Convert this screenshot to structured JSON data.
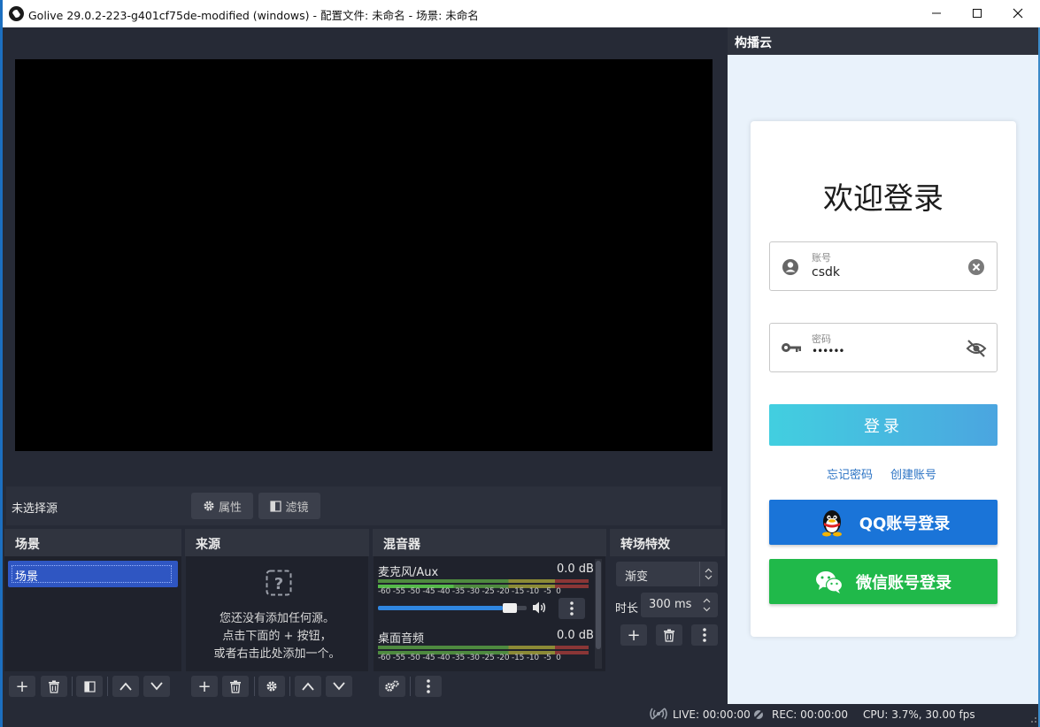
{
  "window": {
    "title": "Golive 29.0.2-223-g401cf75de-modified (windows) - 配置文件: 未命名 - 场景: 未命名",
    "minimize_glyph": "—",
    "maximize_glyph": "☐",
    "close_glyph": "✕"
  },
  "source_toolbar": {
    "no_source": "未选择源",
    "properties_label": "属性",
    "filters_label": "滤镜"
  },
  "scenes": {
    "header": "场景",
    "items": [
      "场景"
    ]
  },
  "sources": {
    "header": "来源",
    "empty_line1": "您还没有添加任何源。",
    "empty_line2": "点击下面的 + 按钮，",
    "empty_line3": "或者右击此处添加一个。"
  },
  "mixer": {
    "header": "混音器",
    "channels": [
      {
        "name": "麦克风/Aux",
        "level": "0.0 dB",
        "volume_fraction": 0.93
      },
      {
        "name": "桌面音频",
        "level": "0.0 dB"
      }
    ],
    "scale": [
      "-60",
      "-55",
      "-50",
      "-45",
      "-40",
      "-35",
      "-30",
      "-25",
      "-20",
      "-15",
      "-10",
      "-5",
      "0"
    ]
  },
  "transitions": {
    "header": "转场特效",
    "selected": "渐变",
    "duration_label": "时长",
    "duration_value": "300 ms"
  },
  "status": {
    "live": "LIVE: 00:00:00",
    "rec": "REC: 00:00:00",
    "cpu": "CPU: 3.7%, 30.00 fps"
  },
  "cloud": {
    "header": "构播云",
    "title": "欢迎登录",
    "account_label": "账号",
    "account_value": "csdk",
    "password_label": "密码",
    "password_value": "••••••",
    "login_button": "登录",
    "forgot_link": "忘记密码",
    "create_link": "创建账号",
    "qq_button": "QQ账号登录",
    "wechat_button": "微信账号登录"
  },
  "colors": {
    "panel_bg": "#262a36",
    "selected_scene": "#2f56c2",
    "qq_blue": "#1a74d8",
    "wechat_green": "#20b94a"
  }
}
